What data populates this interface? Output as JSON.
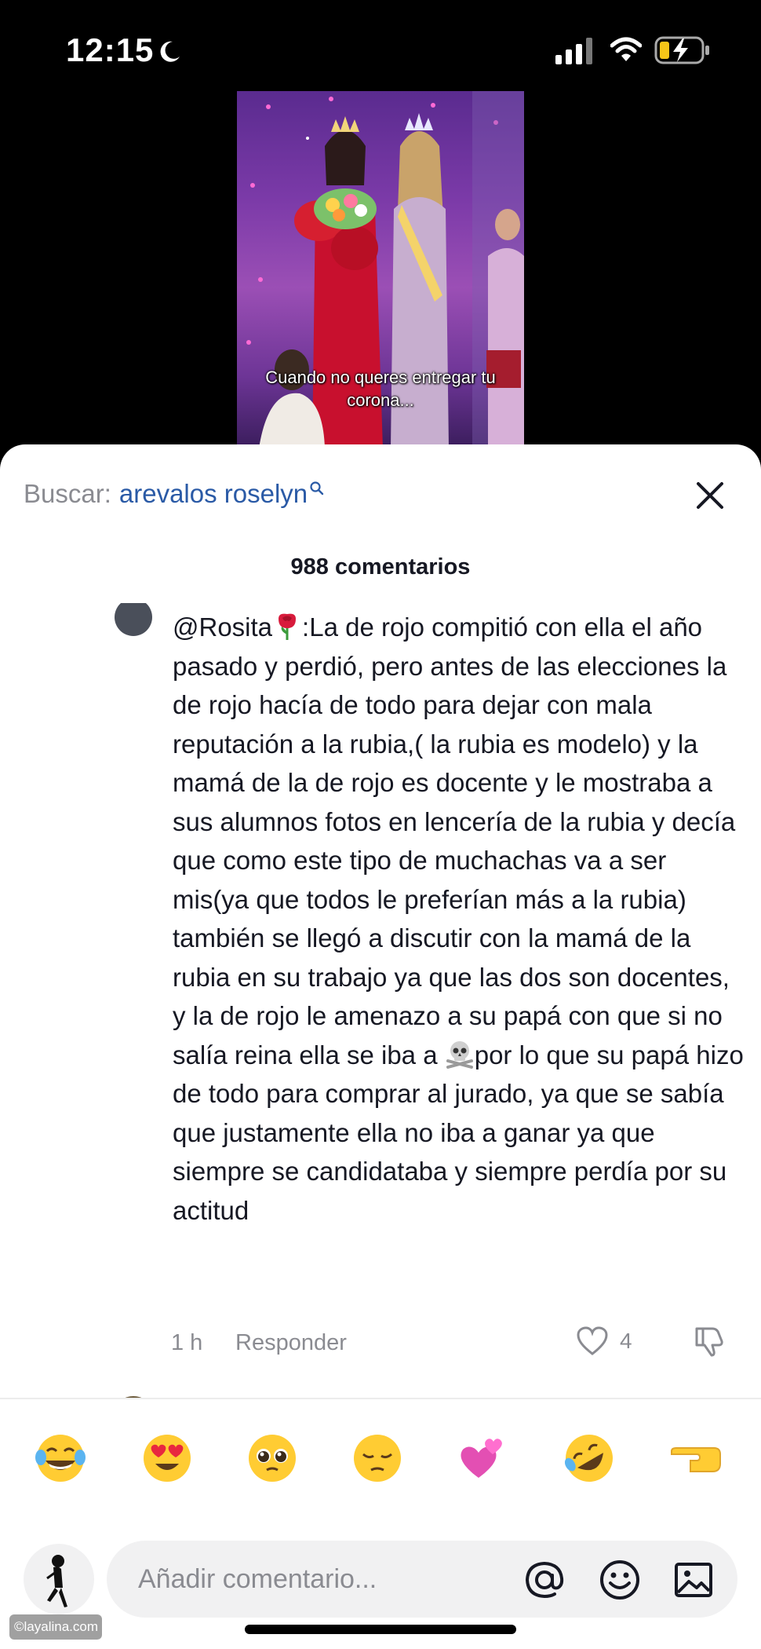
{
  "status_bar": {
    "time": "12:15"
  },
  "video": {
    "caption": "Cuando no queres entregar tu corona..."
  },
  "search": {
    "prefix": "Buscar:",
    "query": "arevalos roselyn"
  },
  "comments": {
    "count_label": "988 comentarios",
    "items": [
      {
        "author": "@Rosita",
        "text_part1": ":La de rojo compitió con ella el año pasado y perdió, pero antes de las elecciones la de rojo hacía de todo para dejar con mala reputación a la rubia,( la rubia es modelo) y la mamá de la de rojo es docente y le mostraba a sus alumnos fotos en lencería de la rubia y decía que como este tipo de muchachas va a ser mis(ya que todos le preferían más a la rubia) también se llegó a discutir con la mamá de la rubia en su trabajo ya que las dos son docentes, y la de rojo le amenazo a su papá con que si no salía reina ella se iba a ",
        "text_part2": "por lo que su papá hizo de todo para comprar al jurado, ya que se sabía que justamente ella no iba a ganar ya que siempre se candidataba y siempre perdía por su actitud",
        "time": "1 h",
        "reply_label": "Responder",
        "likes": "4"
      }
    ]
  },
  "emoji_bar": [
    "face-with-tears-of-joy",
    "heart-eyes",
    "pleading-face",
    "pensive-face",
    "two-hearts",
    "rolling-laughing",
    "pointing-left"
  ],
  "composer": {
    "placeholder": "Añadir comentario..."
  },
  "watermark": "©layalina.com"
}
